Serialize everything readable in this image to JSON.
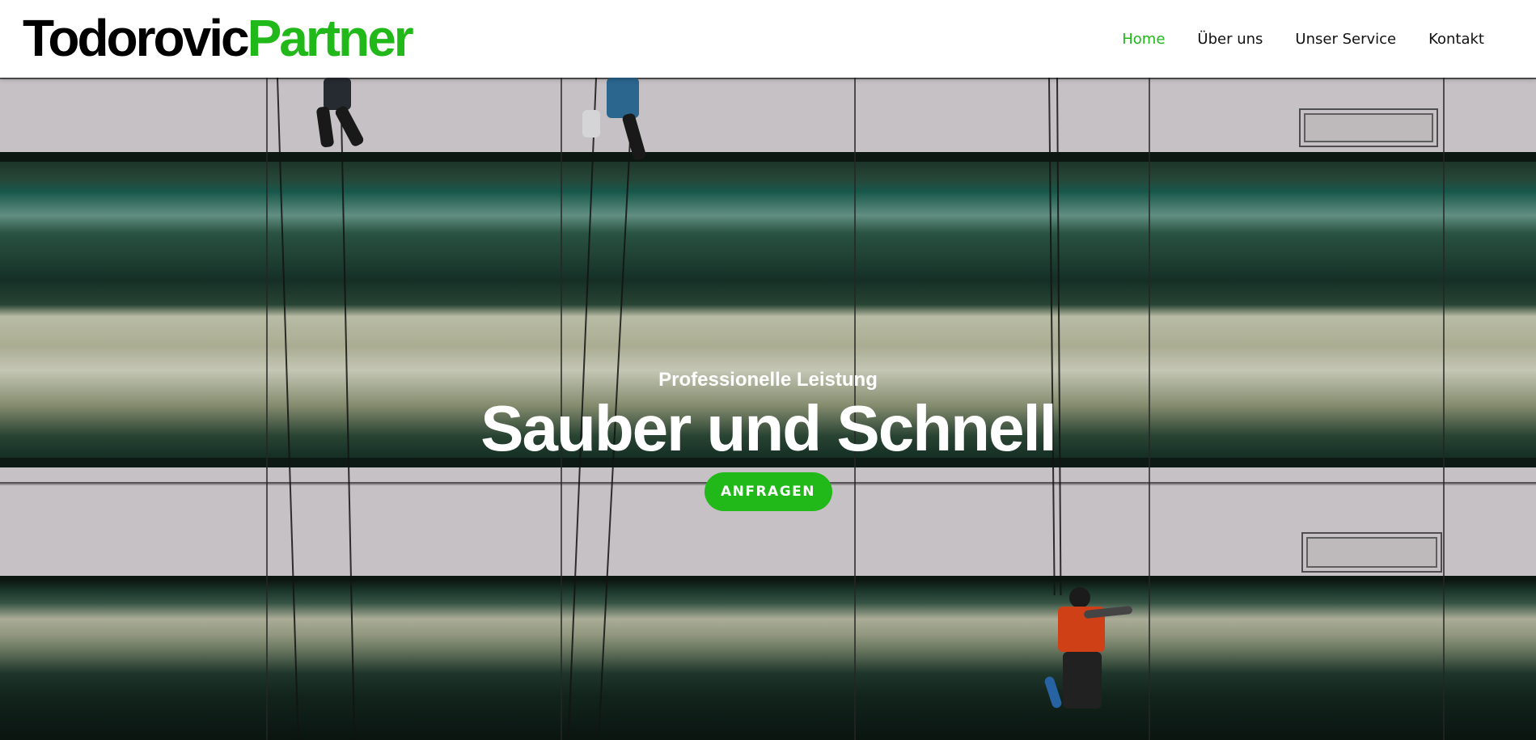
{
  "header": {
    "logo": {
      "part1": "Todorovic",
      "part2": "Partner"
    },
    "nav": [
      {
        "label": "Home",
        "active": true
      },
      {
        "label": "Über uns",
        "active": false
      },
      {
        "label": "Unser Service",
        "active": false
      },
      {
        "label": "Kontakt",
        "active": false
      }
    ]
  },
  "hero": {
    "subtitle": "Professionelle Leistung",
    "title": "Sauber und Schnell",
    "cta_label": "ANFRAGEN"
  },
  "colors": {
    "brand_green": "#21b81a",
    "text_dark": "#111111",
    "white": "#ffffff"
  }
}
